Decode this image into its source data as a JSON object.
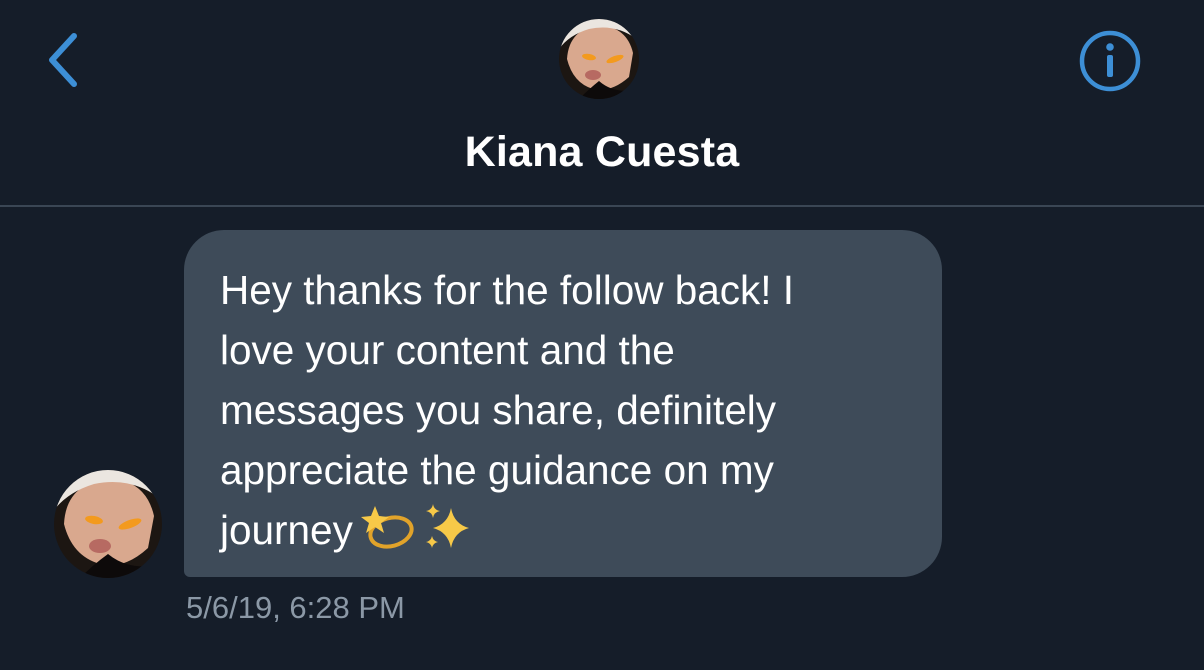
{
  "conversation": {
    "contact_name": "Kiana Cuesta"
  },
  "icons": {
    "back": "chevron-left-icon",
    "info": "info-circle-icon",
    "emoji_1": "dizzy-star-emoji",
    "emoji_2": "sparkles-emoji"
  },
  "colors": {
    "background": "#151d29",
    "accent": "#3d8fd6",
    "bubble": "#3e4b59",
    "timestamp": "#8b98a6"
  },
  "message": {
    "lines": [
      "Hey thanks for the follow back! I",
      "love your content and the",
      "messages you share, definitely",
      "appreciate the guidance on my",
      "journey"
    ],
    "timestamp": "5/6/19, 6:28 PM"
  }
}
